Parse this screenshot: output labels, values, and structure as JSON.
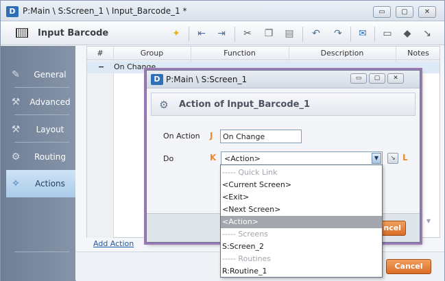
{
  "window": {
    "title": "P:Main \\ S:Screen_1 \\ Input_Barcode_1 *",
    "app_badge": "D",
    "minimize_glyph": "▭",
    "maximize_glyph": "▢",
    "close_glyph": "✕"
  },
  "toolbar": {
    "title": "Input Barcode",
    "icons": [
      "barcode-icon",
      "lightbulb-icon",
      "outdent-icon",
      "indent-icon",
      "cut-icon",
      "copy-icon",
      "paste-icon",
      "undo-icon",
      "redo-icon",
      "comment-icon",
      "note-icon",
      "tag-icon",
      "goto-icon"
    ],
    "glyphs": {
      "bulb": "✦",
      "outdent": "⇤",
      "indent": "⇥",
      "cut": "✂",
      "copy": "❐",
      "paste": "▤",
      "undo": "↶",
      "redo": "↷",
      "comment": "✉",
      "note": "▭",
      "tag": "◆",
      "goto": "↘"
    }
  },
  "sidebar": {
    "items": [
      {
        "label": "General",
        "icon": "general-icon",
        "glyph": "✎"
      },
      {
        "label": "Advanced",
        "icon": "advanced-icon",
        "glyph": "⚒"
      },
      {
        "label": "Layout",
        "icon": "layout-icon",
        "glyph": "⚒"
      },
      {
        "label": "Routing",
        "icon": "routing-icon",
        "glyph": "⚙"
      },
      {
        "label": "Actions",
        "icon": "actions-icon",
        "glyph": "✧"
      }
    ],
    "active": "Actions"
  },
  "grid": {
    "columns": [
      "#",
      "Group",
      "Function",
      "Description",
      "Notes"
    ],
    "rows": [
      {
        "marker": "−",
        "group": "On Change"
      }
    ],
    "add_action_label": "Add Action"
  },
  "main_buttons": {
    "cancel": "Cancel"
  },
  "dialog": {
    "title": "P:Main \\ S:Screen_1",
    "header": "Action of Input_Barcode_1",
    "gear_glyph": "⚙",
    "on_action_label": "On Action",
    "on_action_key": "J",
    "on_action_value": "On Change",
    "do_label": "Do",
    "do_key": "K",
    "do_value": "<Action>",
    "goto_key": "L",
    "dropdown_glyph": "▼",
    "goto_glyph": "↘",
    "cancel_partial": "ncel"
  },
  "dropdown": {
    "options": [
      {
        "text": "----- Quick Link",
        "kind": "group"
      },
      {
        "text": "<Current Screen>",
        "kind": "item"
      },
      {
        "text": "<Exit>",
        "kind": "item"
      },
      {
        "text": "<Next Screen>",
        "kind": "item"
      },
      {
        "text": "<Action>",
        "kind": "selected"
      },
      {
        "text": "----- Screens",
        "kind": "group"
      },
      {
        "text": "S:Screen_2",
        "kind": "item"
      },
      {
        "text": "----- Routines",
        "kind": "group"
      },
      {
        "text": "R:Routine_1",
        "kind": "item"
      }
    ]
  },
  "colors": {
    "accent_orange": "#d86d27",
    "selection_blue": "#a9cbea",
    "key_orange": "#e98a2d",
    "dialog_glow": "#9a7ab4"
  }
}
